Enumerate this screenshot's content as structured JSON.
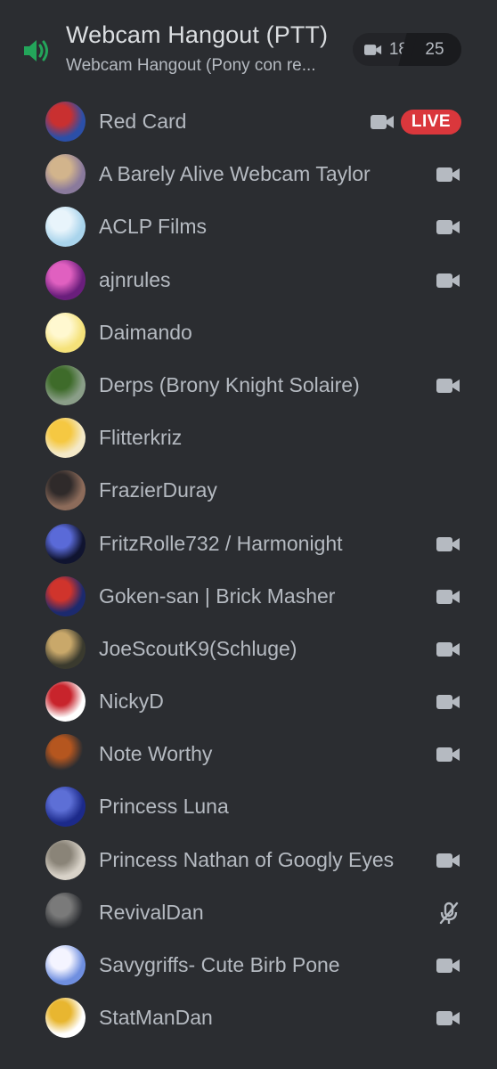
{
  "channel": {
    "title": "Webcam Hangout (PTT)",
    "subtitle": "Webcam Hangout (Pony con re...",
    "video_count": "18",
    "member_count": "25",
    "speaker_icon": "speaker-volume-icon",
    "accent_color": "#23a55a"
  },
  "live_label": "LIVE",
  "colors": {
    "background": "#2b2d31",
    "text": "#b5bac1",
    "live": "#da373c"
  },
  "members": [
    {
      "name": "Red Card",
      "status": "live",
      "avatar_colors": [
        "#2b4fa8",
        "#c93030"
      ]
    },
    {
      "name": "A Barely Alive Webcam Taylor",
      "status": "camera",
      "avatar_colors": [
        "#8a7a9c",
        "#d2b48c"
      ]
    },
    {
      "name": "ACLP Films",
      "status": "camera",
      "avatar_colors": [
        "#a9d4ec",
        "#e8f4fb"
      ]
    },
    {
      "name": "ajnrules",
      "status": "camera",
      "avatar_colors": [
        "#6a1e7c",
        "#e060c0"
      ]
    },
    {
      "name": "Daimando",
      "status": "none",
      "avatar_colors": [
        "#f5e27a",
        "#fff8d0"
      ]
    },
    {
      "name": "Derps (Brony Knight Solaire)",
      "status": "camera",
      "avatar_colors": [
        "#8a9e88",
        "#3e6b2a"
      ]
    },
    {
      "name": "Flitterkriz",
      "status": "none",
      "avatar_colors": [
        "#f4e9c8",
        "#f5c842"
      ]
    },
    {
      "name": "FrazierDuray",
      "status": "none",
      "avatar_colors": [
        "#8c6b5a",
        "#2f2a2a"
      ]
    },
    {
      "name": "FritzRolle732 / Harmonight",
      "status": "camera",
      "avatar_colors": [
        "#101430",
        "#5a6ad8"
      ]
    },
    {
      "name": "Goken-san | Brick Masher",
      "status": "camera",
      "avatar_colors": [
        "#1c2a6e",
        "#d0342c"
      ]
    },
    {
      "name": "JoeScoutK9(Schluge)",
      "status": "camera",
      "avatar_colors": [
        "#3a3a2e",
        "#c9a86a"
      ]
    },
    {
      "name": "NickyD",
      "status": "camera",
      "avatar_colors": [
        "#ffffff",
        "#c8242c"
      ]
    },
    {
      "name": "Note Worthy",
      "status": "camera",
      "avatar_colors": [
        "#2b2d31",
        "#b5561f"
      ]
    },
    {
      "name": "Princess Luna",
      "status": "none",
      "avatar_colors": [
        "#1c2a8a",
        "#5d6fd6"
      ]
    },
    {
      "name": "Princess Nathan of Googly Eyes",
      "status": "camera",
      "avatar_colors": [
        "#d8d2c8",
        "#8a8478"
      ]
    },
    {
      "name": "RevivalDan",
      "status": "muted",
      "avatar_colors": [
        "#2b2d31",
        "#7a7a7a"
      ]
    },
    {
      "name": "Savygriffs- Cute Birb Pone",
      "status": "camera",
      "avatar_colors": [
        "#6f8fe0",
        "#f4f4ff"
      ]
    },
    {
      "name": "StatManDan",
      "status": "camera",
      "avatar_colors": [
        "#ffffff",
        "#e8b630"
      ]
    }
  ]
}
